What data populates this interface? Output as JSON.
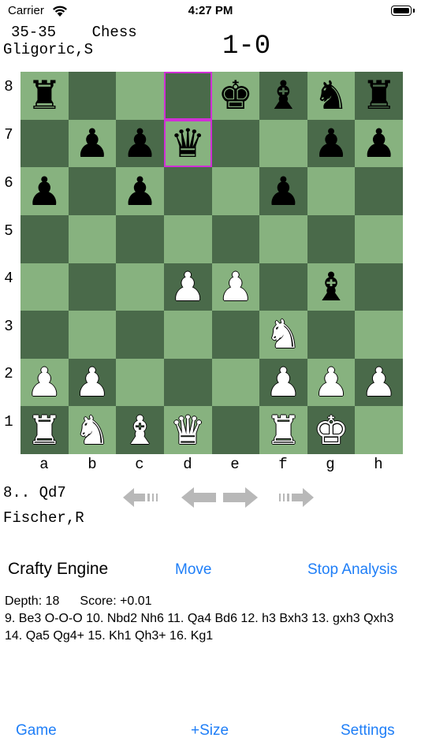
{
  "status_bar": {
    "carrier": "Carrier",
    "time": "4:27 PM"
  },
  "header": {
    "game_info": "35-35    Chess",
    "white_player": "Gligoric,S",
    "result": "1-0"
  },
  "board": {
    "rank_labels": [
      "8",
      "7",
      "6",
      "5",
      "4",
      "3",
      "2",
      "1"
    ],
    "file_labels": [
      "a",
      "b",
      "c",
      "d",
      "e",
      "f",
      "g",
      "h"
    ],
    "highlight_squares": [
      "d8",
      "d7"
    ],
    "colors": {
      "light": "#87b27f",
      "dark": "#4a6a4a",
      "highlight": "#d02fd6"
    },
    "position": [
      [
        "bR",
        "",
        "",
        "",
        "bK",
        "bB",
        "bN",
        "bR"
      ],
      [
        "",
        "bP",
        "bP",
        "bQ",
        "",
        "",
        "bP",
        "bP"
      ],
      [
        "bP",
        "",
        "bP",
        "",
        "",
        "bP",
        "",
        ""
      ],
      [
        "",
        "",
        "",
        "",
        "",
        "",
        "",
        ""
      ],
      [
        "",
        "",
        "",
        "wP",
        "wP",
        "",
        "bB",
        ""
      ],
      [
        "",
        "",
        "",
        "",
        "",
        "wN",
        "",
        ""
      ],
      [
        "wP",
        "wP",
        "",
        "",
        "",
        "wP",
        "wP",
        "wP"
      ],
      [
        "wR",
        "wN",
        "wB",
        "wQ",
        "",
        "wR",
        "wK",
        ""
      ]
    ]
  },
  "move_panel": {
    "last_move": "8.. Qd7",
    "black_player": "Fischer,R",
    "nav_icons": [
      "first-move-icon",
      "previous-move-icon",
      "next-move-icon",
      "last-move-icon"
    ]
  },
  "engine": {
    "name": "Crafty Engine",
    "move_label": "Move",
    "stop_label": "Stop Analysis",
    "depth_label": "Depth: 18",
    "score_label": "Score: +0.01",
    "pv": "9. Be3 O-O-O 10. Nbd2 Nh6 11. Qa4 Bd6 12. h3 Bxh3 13. gxh3 Qxh3 14. Qa5 Qg4+ 15. Kh1 Qh3+ 16. Kg1"
  },
  "toolbar": {
    "game_label": "Game",
    "size_label": "+Size",
    "settings_label": "Settings"
  },
  "accent_color": "#1e7ef7"
}
